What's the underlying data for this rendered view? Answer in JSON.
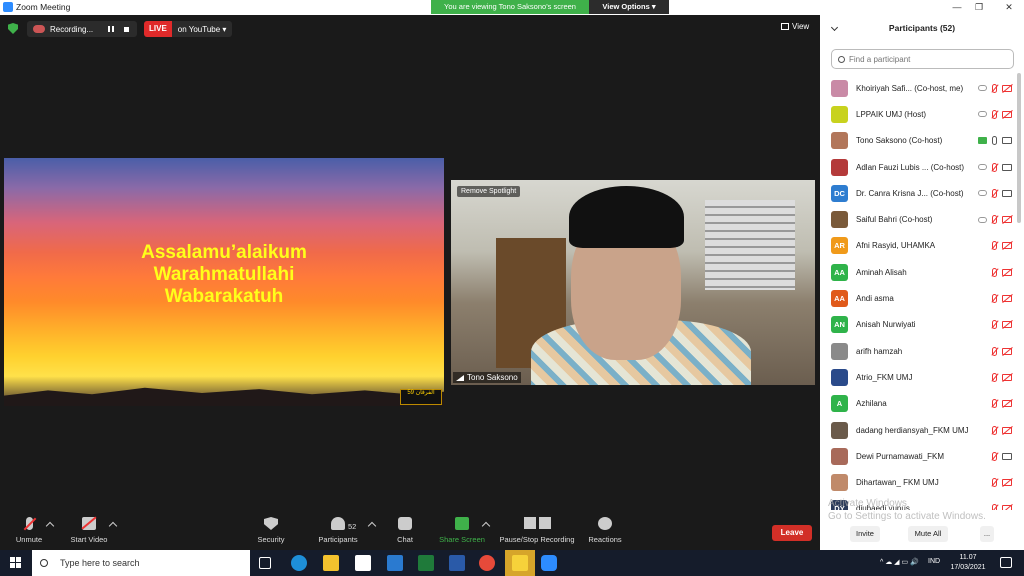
{
  "window": {
    "title": "Zoom Meeting",
    "minimize": "—",
    "maximize": "❐",
    "close": "✕"
  },
  "banner": {
    "message": "You are viewing Tono Saksono's screen",
    "options": "View Options ▾"
  },
  "recording": {
    "label": "Recording...",
    "live_badge": "LIVE",
    "live_target": "on YouTube ▾"
  },
  "view_label": "View",
  "shared_content": {
    "greeting_lines": [
      "Assalamu’alaikum",
      "Warahmatullahi",
      "Wabarakatuh"
    ],
    "logo_text": "الفرقان 59"
  },
  "video": {
    "spotlight": "Remove Spotlight",
    "name": "Tono Saksono"
  },
  "toolbar": {
    "unmute": "Unmute",
    "start_video": "Start Video",
    "security": "Security",
    "participants": "Participants",
    "participant_count": "52",
    "chat": "Chat",
    "share_screen": "Share Screen",
    "recording": "Pause/Stop Recording",
    "reactions": "Reactions",
    "leave": "Leave"
  },
  "panel": {
    "title": "Participants (52)",
    "search_placeholder": "Find a participant",
    "invite": "Invite",
    "mute_all": "Mute All",
    "more": "...",
    "watermark_line1": "Activate Windows",
    "watermark_line2": "Go to Settings to activate Windows.",
    "participants": [
      {
        "name": "Khoiriyah Safi... (Co-host, me)",
        "initials": "",
        "color": "#c98aa6",
        "cloud": true,
        "share": false,
        "mic": "off",
        "cam": "off"
      },
      {
        "name": "LPPAIK UMJ (Host)",
        "initials": "",
        "color": "#c8d21e",
        "cloud": true,
        "share": false,
        "mic": "off",
        "cam": "off"
      },
      {
        "name": "Tono Saksono (Co-host)",
        "initials": "",
        "color": "#b2765a",
        "cloud": false,
        "share": true,
        "mic": "on",
        "cam": "on"
      },
      {
        "name": "Adlan Fauzi Lubis ... (Co-host)",
        "initials": "",
        "color": "#b43a3a",
        "cloud": true,
        "share": false,
        "mic": "off",
        "cam": "on"
      },
      {
        "name": "Dr. Canra Krisna J... (Co-host)",
        "initials": "DC",
        "color": "#2e7dd0",
        "cloud": true,
        "share": false,
        "mic": "off",
        "cam": "on"
      },
      {
        "name": "Saiful Bahri (Co-host)",
        "initials": "",
        "color": "#7a5a3a",
        "cloud": true,
        "share": false,
        "mic": "off",
        "cam": "off"
      },
      {
        "name": "Afni Rasyid, UHAMKA",
        "initials": "AR",
        "color": "#f09a1a",
        "cloud": false,
        "share": false,
        "mic": "off",
        "cam": "off"
      },
      {
        "name": "Aminah Alisah",
        "initials": "AA",
        "color": "#2fb34a",
        "cloud": false,
        "share": false,
        "mic": "off",
        "cam": "off"
      },
      {
        "name": "Andi asma",
        "initials": "AA",
        "color": "#e05a1a",
        "cloud": false,
        "share": false,
        "mic": "off",
        "cam": "off"
      },
      {
        "name": "Anisah Nurwiyati",
        "initials": "AN",
        "color": "#2fb34a",
        "cloud": false,
        "share": false,
        "mic": "off",
        "cam": "off"
      },
      {
        "name": "arifh hamzah",
        "initials": "",
        "color": "#8a8a8a",
        "cloud": false,
        "share": false,
        "mic": "off",
        "cam": "off"
      },
      {
        "name": "Atrio_FKM UMJ",
        "initials": "",
        "color": "#2a4a8a",
        "cloud": false,
        "share": false,
        "mic": "off",
        "cam": "off"
      },
      {
        "name": "Azhilana",
        "initials": "A",
        "color": "#2fb34a",
        "cloud": false,
        "share": false,
        "mic": "off",
        "cam": "off"
      },
      {
        "name": "dadang herdiansyah_FKM UMJ",
        "initials": "",
        "color": "#6a5a4a",
        "cloud": false,
        "share": false,
        "mic": "off",
        "cam": "off"
      },
      {
        "name": "Dewi Purnamawati_FKM",
        "initials": "",
        "color": "#a86a5a",
        "cloud": false,
        "share": false,
        "mic": "off",
        "cam": "on"
      },
      {
        "name": "Dihartawan_ FKM UMJ",
        "initials": "",
        "color": "#c08a6a",
        "cloud": false,
        "share": false,
        "mic": "off",
        "cam": "off"
      },
      {
        "name": "djubaedi yunus",
        "initials": "DY",
        "color": "#2a3a5a",
        "cloud": false,
        "share": false,
        "mic": "off",
        "cam": "off"
      }
    ]
  },
  "taskbar": {
    "search_placeholder": "Type here to search",
    "lang": "IND",
    "time": "11.07",
    "date": "17/03/2021",
    "tray": "^ ☁ ◢ ▭ 🔊"
  }
}
